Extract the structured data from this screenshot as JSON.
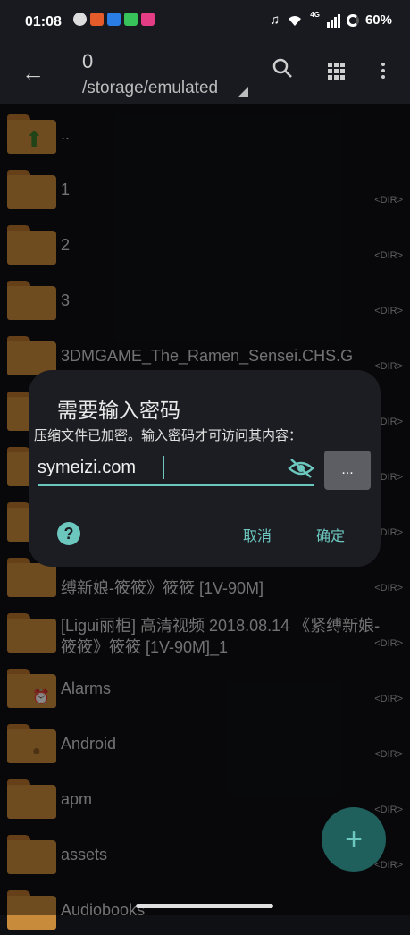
{
  "status": {
    "time": "01:08",
    "network": "4G",
    "battery": "60%"
  },
  "toolbar": {
    "title": "0",
    "path": "/storage/emulated"
  },
  "files": [
    {
      "name": "..",
      "emblem": "up-arrow",
      "dir": ""
    },
    {
      "name": "1",
      "dir": "<DIR>"
    },
    {
      "name": "2",
      "dir": "<DIR>"
    },
    {
      "name": "3",
      "dir": "<DIR>"
    },
    {
      "name": "3DMGAME_The_Ramen_Sensei.CHS.G",
      "dir": "<DIR>"
    },
    {
      "name": "",
      "dir": "<DIR>"
    },
    {
      "name": "",
      "dir": "<DIR>"
    },
    {
      "name": "",
      "dir": "<DIR>"
    },
    {
      "name": "缚新娘-筱筱》筱筱 [1V-90M]",
      "dir": "<DIR>"
    },
    {
      "name": "[Ligui丽柜] 高清视频 2018.08.14 《紧缚新娘-筱筱》筱筱 [1V-90M]_1",
      "dir": "<DIR>"
    },
    {
      "name": "Alarms",
      "emblem": "alarm",
      "dir": "<DIR>"
    },
    {
      "name": "Android",
      "emblem": "android",
      "dir": "<DIR>"
    },
    {
      "name": "apm",
      "dir": "<DIR>"
    },
    {
      "name": "assets",
      "dir": "<DIR>"
    },
    {
      "name": "Audiobooks",
      "dir": ""
    }
  ],
  "dialog": {
    "title": "需要输入密码",
    "message": "压缩文件已加密。输入密码才可访问其内容：",
    "password_value": "symeizi.com",
    "more_label": "...",
    "help_label": "?",
    "cancel_label": "取消",
    "ok_label": "确定"
  },
  "fab": {
    "label": "+"
  },
  "colors": {
    "accent": "#6cc7bf",
    "folder": "#c88a3b",
    "background": "#0f1013"
  }
}
